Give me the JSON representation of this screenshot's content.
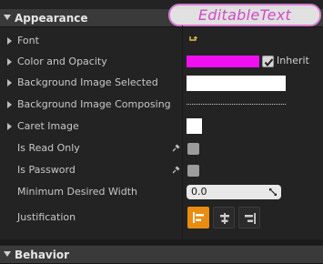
{
  "overlay_title": "EditableText",
  "section": {
    "title": "Appearance"
  },
  "next_section": {
    "title": "Behavior"
  },
  "properties": {
    "font": {
      "label": "Font"
    },
    "color_and_opacity": {
      "label": "Color and Opacity",
      "color": "#f00ff0",
      "inherit_label": "Inherit",
      "inherit_checked": true
    },
    "bg_selected": {
      "label": "Background Image Selected",
      "color": "#ffffff"
    },
    "bg_composing": {
      "label": "Background Image Composing"
    },
    "caret_image": {
      "label": "Caret Image",
      "color": "#ffffff"
    },
    "is_read_only": {
      "label": "Is Read Only",
      "checked": false
    },
    "is_password": {
      "label": "Is Password",
      "checked": false
    },
    "min_width": {
      "label": "Minimum Desired Width",
      "value": "0.0"
    },
    "justification": {
      "label": "Justification",
      "options": [
        "left",
        "center",
        "right"
      ],
      "selected": "left"
    }
  },
  "colors": {
    "accent": "#e98d12",
    "overlay_text": "#d24bc6",
    "overlay_border": "#d77ad0"
  }
}
